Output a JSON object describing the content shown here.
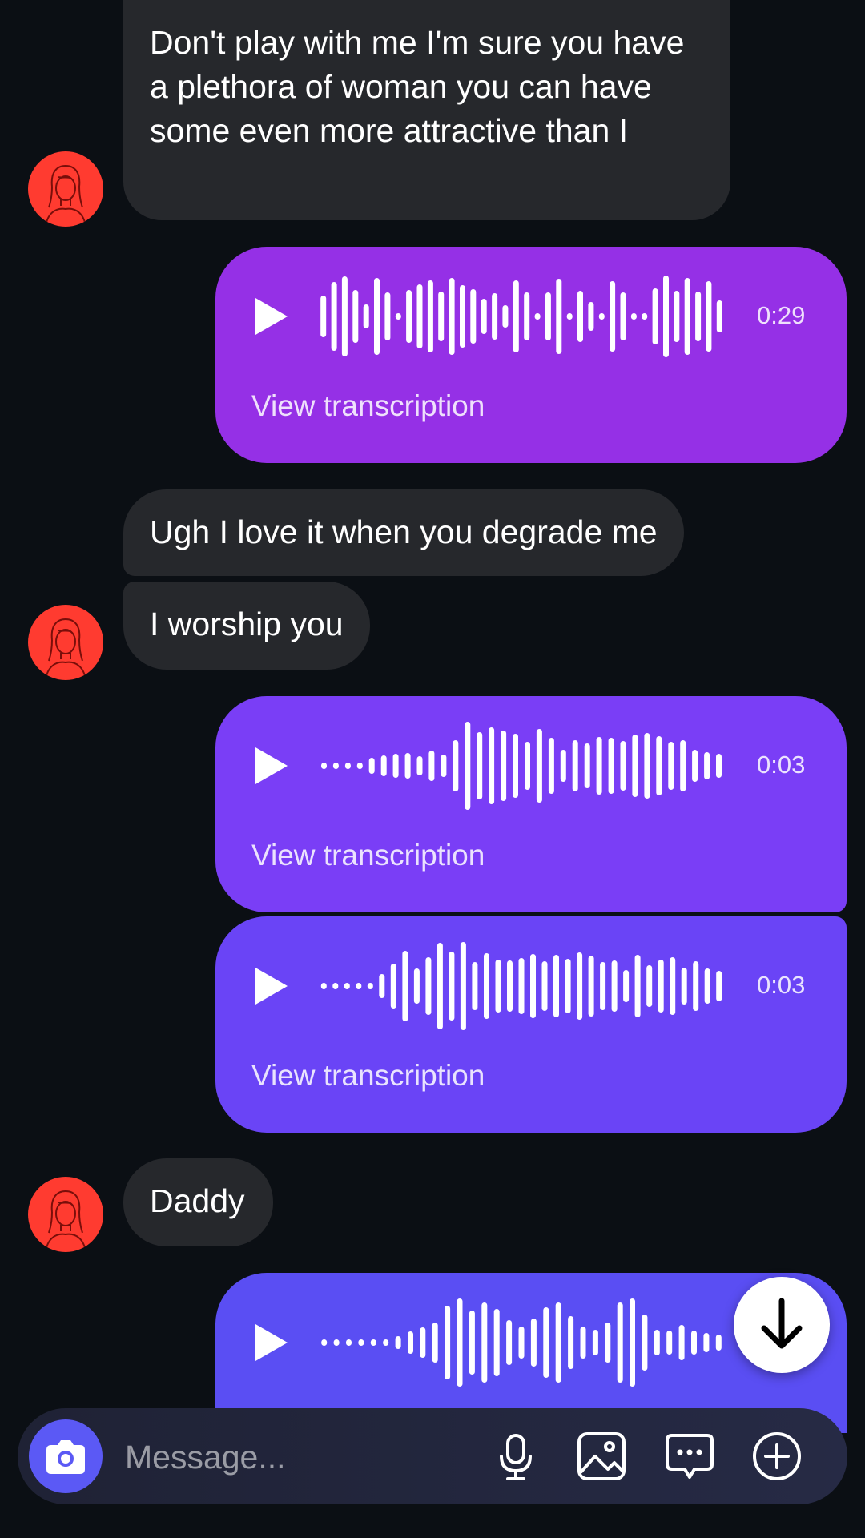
{
  "messages": {
    "m1": {
      "text": "Don't play with me I'm sure you have a plethora of woman you can have some even more attractive than I"
    },
    "v1": {
      "duration": "0:29",
      "transcription_label": "View transcription",
      "color": "#9530e6"
    },
    "m2": {
      "text": "Ugh I love it when you degrade me"
    },
    "m3": {
      "text": "I worship you"
    },
    "v2": {
      "duration": "0:03",
      "transcription_label": "View transcription",
      "color": "#7a3ef6"
    },
    "v3": {
      "duration": "0:03",
      "transcription_label": "View transcription",
      "color": "#6a44f6"
    },
    "m4": {
      "text": "Daddy"
    },
    "v4": {
      "color": "#5a4ef3"
    }
  },
  "composer": {
    "placeholder": "Message...",
    "icons": [
      "camera-icon",
      "microphone-icon",
      "image-icon",
      "sticker-chat-icon",
      "plus-icon"
    ]
  },
  "controls": {
    "scroll_down_icon": "arrow-down-icon"
  }
}
